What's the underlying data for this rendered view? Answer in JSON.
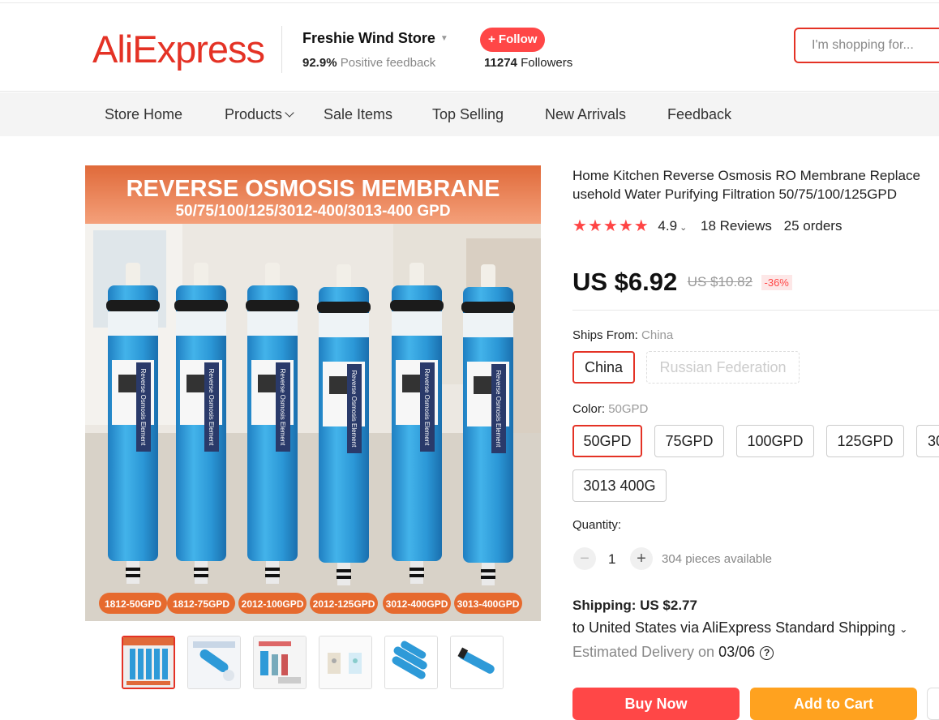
{
  "header": {
    "logo": "AliExpress",
    "store_name": "Freshie Wind Store",
    "feedback_pct": "92.9%",
    "feedback_label": "Positive feedback",
    "follow_label": "+ Follow",
    "followers_count": "11274",
    "followers_label": "Followers",
    "search_placeholder": "I'm shopping for..."
  },
  "nav": {
    "items": [
      "Store Home",
      "Products",
      "Sale Items",
      "Top Selling",
      "New Arrivals",
      "Feedback"
    ]
  },
  "image": {
    "banner_title": "REVERSE OSMOSIS MEMBRANE",
    "banner_subtitle": "50/75/100/125/3012-400/3013-400 GPD",
    "tags": [
      "1812-50GPD",
      "1812-75GPD",
      "2012-100GPD",
      "2012-125GPD",
      "3012-400GPD",
      "3013-400GPD"
    ],
    "tube_label": "Reverse Osmosis Element"
  },
  "product": {
    "title": "Home Kitchen Reverse Osmosis RO Membrane Replace\nusehold Water Purifying Filtration 50/75/100/125GPD",
    "rating": "4.9",
    "reviews": "18 Reviews",
    "orders": "25 orders",
    "price": "US $6.92",
    "old_price": "US $10.82",
    "discount": "-36%"
  },
  "ships_from": {
    "label": "Ships From:",
    "selected": "China",
    "options": [
      "China",
      "Russian Federation"
    ]
  },
  "color": {
    "label": "Color:",
    "selected": "50GPD",
    "options": [
      "50GPD",
      "75GPD",
      "100GPD",
      "125GPD",
      "30",
      "3013 400G"
    ]
  },
  "quantity": {
    "label": "Quantity:",
    "minus": "−",
    "value": "1",
    "plus": "+",
    "available": "304 pieces available"
  },
  "shipping": {
    "label": "Shipping: US $2.77",
    "method": "to United States via AliExpress Standard Shipping",
    "delivery_label": "Estimated Delivery on",
    "delivery_date": "03/06",
    "help": "?"
  },
  "buttons": {
    "buy": "Buy Now",
    "cart": "Add to Cart"
  },
  "colors": {
    "accent": "#e43225",
    "follow": "#ff4747",
    "buy": "#ff4747",
    "cart": "#ffa21f",
    "tube": "#2e9ad8"
  }
}
